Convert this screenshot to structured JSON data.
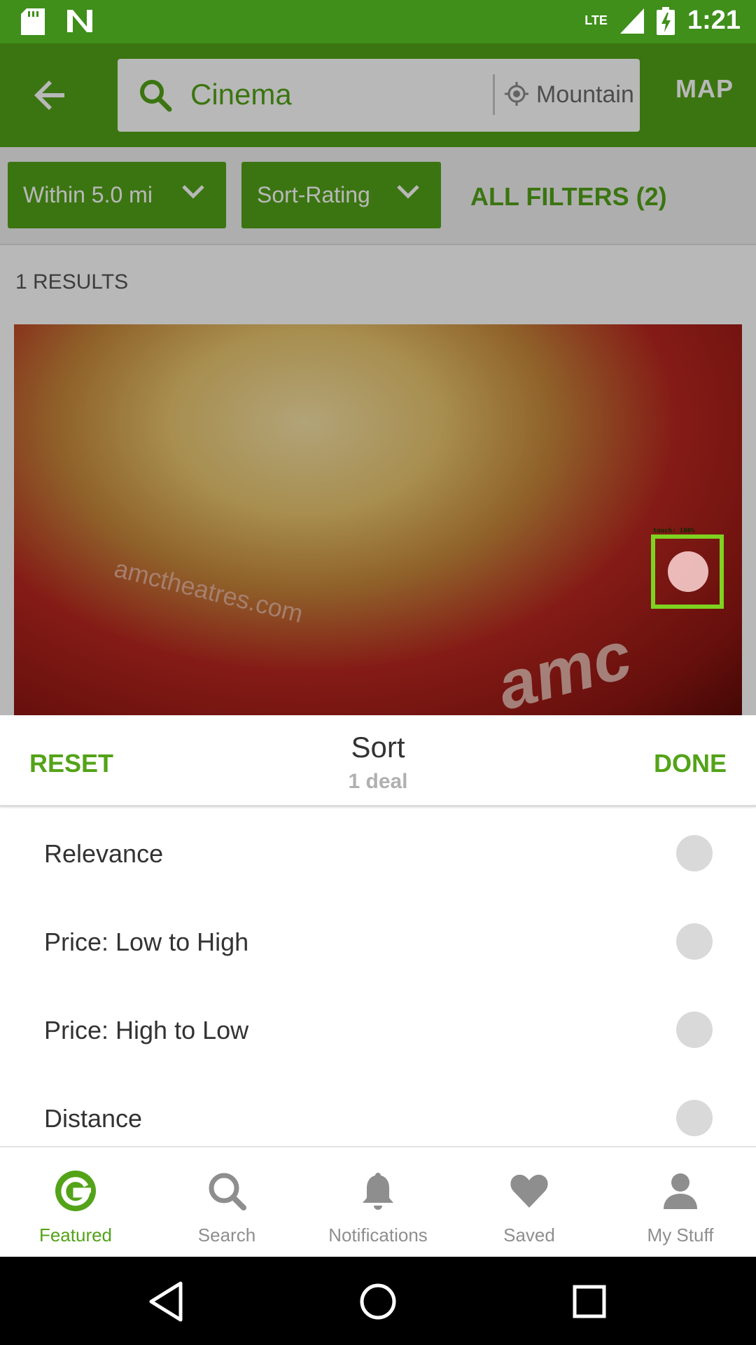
{
  "status_bar": {
    "time": "1:21",
    "network": "LTE"
  },
  "search": {
    "query": "Cinema",
    "location": "Mountain View"
  },
  "app_bar": {
    "map_label": "MAP"
  },
  "filters": {
    "distance_chip": "Within 5.0 mi",
    "sort_chip": "Sort-Rating",
    "all_filters": "ALL FILTERS (2)"
  },
  "results": {
    "count": "1 RESULTS",
    "image_box_text": "amctheatres.com",
    "image_logo_text": "amc"
  },
  "overlay": {
    "touch_label": "touch: 100%"
  },
  "sheet": {
    "reset": "RESET",
    "title": "Sort",
    "subtitle": "1 deal",
    "done": "DONE",
    "options": [
      {
        "label": "Relevance"
      },
      {
        "label": "Price: Low to High"
      },
      {
        "label": "Price: High to Low"
      },
      {
        "label": "Distance"
      }
    ]
  },
  "bottom_nav": {
    "items": [
      {
        "label": "Featured",
        "icon": "groupon-g-icon"
      },
      {
        "label": "Search",
        "icon": "search-icon"
      },
      {
        "label": "Notifications",
        "icon": "bell-icon"
      },
      {
        "label": "Saved",
        "icon": "heart-icon"
      },
      {
        "label": "My Stuff",
        "icon": "person-icon"
      }
    ]
  },
  "colors": {
    "brand": "#53a318",
    "status_bar": "#3f8f1a"
  }
}
